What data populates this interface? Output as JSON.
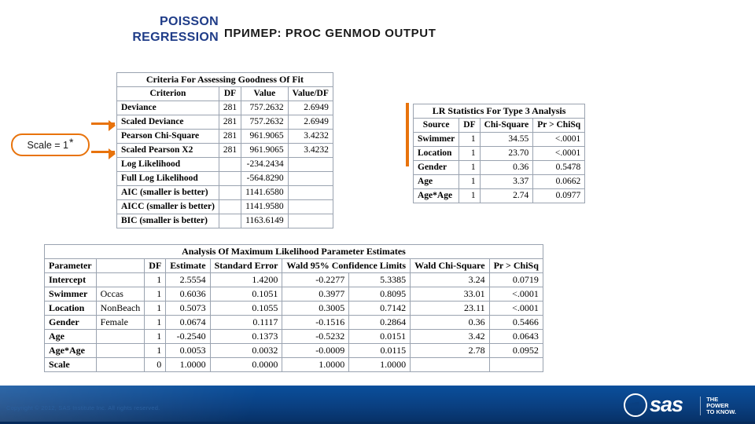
{
  "header": {
    "title": "POISSON REGRESSION",
    "subtitle": "ПРИМЕР: PROC GENMOD OUTPUT"
  },
  "callout": {
    "text": "Scale = 1",
    "star": "*"
  },
  "gof_table": {
    "caption": "Criteria For Assessing Goodness Of Fit",
    "columns": [
      "Criterion",
      "DF",
      "Value",
      "Value/DF"
    ],
    "rows": [
      [
        "Deviance",
        "281",
        "757.2632",
        "2.6949"
      ],
      [
        "Scaled Deviance",
        "281",
        "757.2632",
        "2.6949"
      ],
      [
        "Pearson Chi-Square",
        "281",
        "961.9065",
        "3.4232"
      ],
      [
        "Scaled Pearson X2",
        "281",
        "961.9065",
        "3.4232"
      ],
      [
        "Log Likelihood",
        "",
        "-234.2434",
        ""
      ],
      [
        "Full Log Likelihood",
        "",
        "-564.8290",
        ""
      ],
      [
        "AIC (smaller is better)",
        "",
        "1141.6580",
        ""
      ],
      [
        "AICC (smaller is better)",
        "",
        "1141.9580",
        ""
      ],
      [
        "BIC (smaller is better)",
        "",
        "1163.6149",
        ""
      ]
    ]
  },
  "lr_table": {
    "caption": "LR Statistics For Type 3 Analysis",
    "columns": [
      "Source",
      "DF",
      "Chi-Square",
      "Pr > ChiSq"
    ],
    "rows": [
      [
        "Swimmer",
        "1",
        "34.55",
        "<.0001"
      ],
      [
        "Location",
        "1",
        "23.70",
        "<.0001"
      ],
      [
        "Gender",
        "1",
        "0.36",
        "0.5478"
      ],
      [
        "Age",
        "1",
        "3.37",
        "0.0662"
      ],
      [
        "Age*Age",
        "1",
        "2.74",
        "0.0977"
      ]
    ]
  },
  "mle_table": {
    "caption": "Analysis Of Maximum Likelihood Parameter Estimates",
    "columns": [
      "Parameter",
      "",
      "DF",
      "Estimate",
      "Standard Error",
      "Wald 95% Confidence Limits",
      "Wald Chi-Square",
      "Pr > ChiSq"
    ],
    "ci_subcols": [
      "",
      ""
    ],
    "rows": [
      [
        "Intercept",
        "",
        "1",
        "2.5554",
        "1.4200",
        "-0.2277",
        "5.3385",
        "3.24",
        "0.0719"
      ],
      [
        "Swimmer",
        "Occas",
        "1",
        "0.6036",
        "0.1051",
        "0.3977",
        "0.8095",
        "33.01",
        "<.0001"
      ],
      [
        "Location",
        "NonBeach",
        "1",
        "0.5073",
        "0.1055",
        "0.3005",
        "0.7142",
        "23.11",
        "<.0001"
      ],
      [
        "Gender",
        "Female",
        "1",
        "0.0674",
        "0.1117",
        "-0.1516",
        "0.2864",
        "0.36",
        "0.5466"
      ],
      [
        "Age",
        "",
        "1",
        "-0.2540",
        "0.1373",
        "-0.5232",
        "0.0151",
        "3.42",
        "0.0643"
      ],
      [
        "Age*Age",
        "",
        "1",
        "0.0053",
        "0.0032",
        "-0.0009",
        "0.0115",
        "2.78",
        "0.0952"
      ],
      [
        "Scale",
        "",
        "0",
        "1.0000",
        "0.0000",
        "1.0000",
        "1.0000",
        "",
        ""
      ]
    ]
  },
  "footer": {
    "copyright": "Copyright © 2012, SAS Institute Inc. All rights reserved.",
    "logo_text": "sas",
    "tagline_line1": "THE",
    "tagline_line2": "POWER",
    "tagline_line3": "TO KNOW."
  },
  "colors": {
    "accent_orange": "#e8730c",
    "title_blue": "#1f3c88",
    "footer_blue": "#0a3f80"
  }
}
